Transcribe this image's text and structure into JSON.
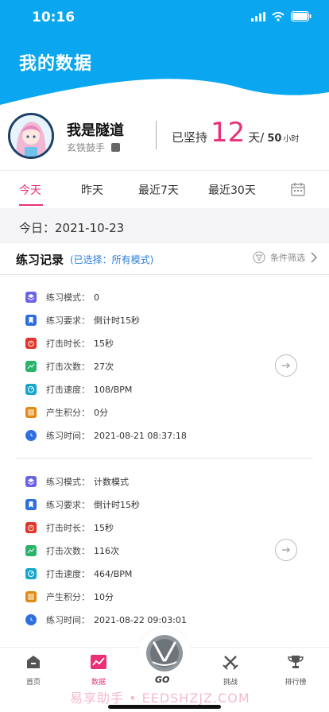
{
  "status_bar": {
    "time": "10:16"
  },
  "header": {
    "title": "我的数据",
    "bg_color": "#0aa7f0"
  },
  "profile": {
    "username": "我是隧道",
    "level": "玄铁鼓手",
    "streak_prefix": "已坚持",
    "streak_days": "12",
    "streak_unit": "天/",
    "goal_value": "50",
    "goal_unit": "小时"
  },
  "tabs": [
    {
      "label": "今天",
      "active": true
    },
    {
      "label": "昨天",
      "active": false
    },
    {
      "label": "最近7天",
      "active": false
    },
    {
      "label": "最近30天",
      "active": false
    }
  ],
  "date": {
    "label": "今日：2021-10-23"
  },
  "records_header": {
    "title": "练习记录",
    "selected": "(已选择：所有模式)",
    "filter_label": "条件筛选"
  },
  "field_labels": {
    "mode": "练习模式：",
    "requirement": "练习要求：",
    "duration": "打击时长：",
    "count": "打击次数：",
    "speed": "打击速度：",
    "points": "产生积分：",
    "time": "练习时间："
  },
  "records": [
    {
      "mode": "0",
      "requirement": "倒计时15秒",
      "duration": "15秒",
      "count": "27次",
      "speed": "108/BPM",
      "points": "0分",
      "time": "2021-08-21 08:37:18"
    },
    {
      "mode": "计数模式",
      "requirement": "倒计时15秒",
      "duration": "15秒",
      "count": "116次",
      "speed": "464/BPM",
      "points": "10分",
      "time": "2021-08-22 09:03:01"
    }
  ],
  "tabbar": {
    "items": [
      {
        "label": "首页",
        "icon": "home-icon"
      },
      {
        "label": "数据",
        "icon": "chart-icon",
        "active": true
      },
      {
        "label": "挑战",
        "icon": "swords-icon"
      },
      {
        "label": "排行榜",
        "icon": "trophy-icon"
      }
    ],
    "center_label": "GO",
    "watermark": "易享助手 • EEDSHZJZ.COM"
  },
  "colors": {
    "accent": "#e93079",
    "header": "#0aa7f0",
    "link": "#2a7de1"
  }
}
